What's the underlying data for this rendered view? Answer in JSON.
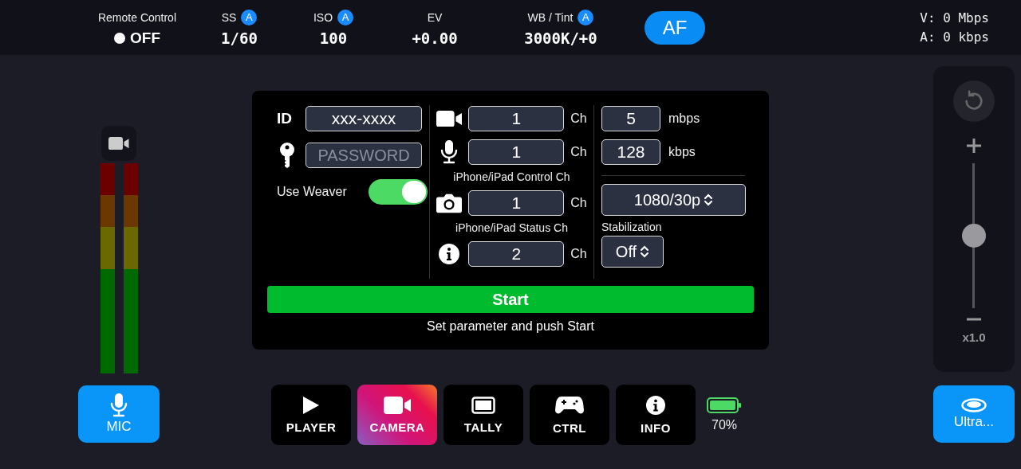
{
  "top_bar": {
    "remote": {
      "label": "Remote Control",
      "value": "OFF"
    },
    "settings": [
      {
        "label": "SS",
        "badge": "A",
        "value": "1/60"
      },
      {
        "label": "ISO",
        "badge": "A",
        "value": "100"
      },
      {
        "label": "EV",
        "value": "+0.00"
      },
      {
        "label": "WB / Tint",
        "badge": "A",
        "value": "3000K/+0"
      }
    ],
    "af_button": "AF",
    "rates": [
      "V: 0 Mbps",
      "A: 0 kbps"
    ]
  },
  "meters": [
    {
      "level": 0
    },
    {
      "level": 0
    }
  ],
  "mic_button": "MIC",
  "panel": {
    "id_label": "ID",
    "id_value": "xxx-xxxx",
    "password_placeholder": "PASSWORD",
    "weaver": {
      "label": "Use Weaver",
      "on": true
    },
    "channels": [
      {
        "kind": "video",
        "value": "1",
        "unit": "Ch"
      },
      {
        "kind": "audio",
        "value": "1",
        "unit": "Ch",
        "caption": "iPhone/iPad Control Ch"
      },
      {
        "kind": "photo",
        "value": "1",
        "unit": "Ch",
        "caption": "iPhone/iPad Status Ch"
      },
      {
        "kind": "info",
        "value": "2",
        "unit": "Ch"
      }
    ],
    "bitrates": [
      {
        "value": "5",
        "unit": "mbps"
      },
      {
        "value": "128",
        "unit": "kbps"
      }
    ],
    "format": "1080/30p",
    "stabilization": {
      "label": "Stabilization",
      "value": "Off"
    },
    "start_button": "Start",
    "hint": "Set parameter and push Start"
  },
  "tabs": [
    {
      "kind": "player",
      "label": "PLAYER",
      "selected": false
    },
    {
      "kind": "camera",
      "label": "CAMERA",
      "selected": true
    },
    {
      "kind": "tally",
      "label": "TALLY",
      "selected": false
    },
    {
      "kind": "ctrl",
      "label": "CTRL",
      "selected": false
    },
    {
      "kind": "info",
      "label": "INFO",
      "selected": false
    }
  ],
  "battery": "70%",
  "zoom": {
    "level": 0.5,
    "reading": "x1.0"
  },
  "lens_button": "Ultra..."
}
